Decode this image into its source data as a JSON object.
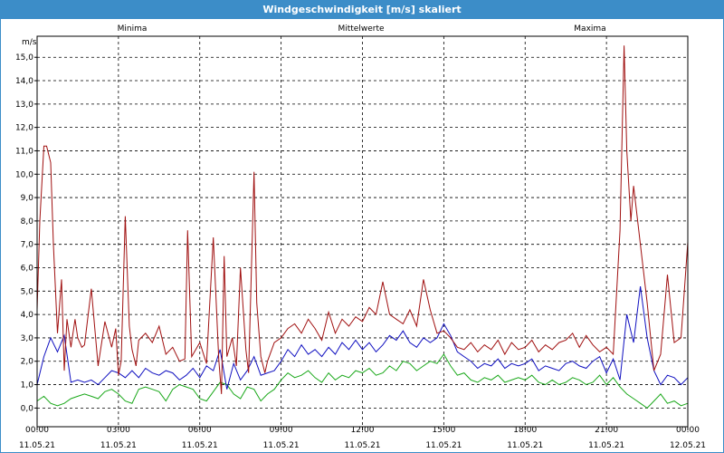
{
  "window": {
    "title": "Windgeschwindigkeit [m/s] skaliert"
  },
  "colors": {
    "min": "#1aa81a",
    "mean": "#1010c0",
    "max": "#a01010",
    "grid": "#000000",
    "titlebar": "#3c8dc8"
  },
  "chart_data": {
    "type": "line",
    "title": "Windgeschwindigkeit [m/s] skaliert",
    "ylabel": "m/s",
    "ylim": [
      -0.8,
      15.9
    ],
    "xlim": [
      0,
      24
    ],
    "grid": true,
    "legend_placement": "top",
    "x_unit": "hours since 11.05.21 00:00",
    "yticks": [
      "0,0",
      "1,0",
      "2,0",
      "3,0",
      "4,0",
      "5,0",
      "6,0",
      "7,0",
      "8,0",
      "9,0",
      "10,0",
      "11,0",
      "12,0",
      "13,0",
      "14,0",
      "15,0"
    ],
    "xticks": [
      {
        "time": "00:00",
        "date": "11.05.21"
      },
      {
        "time": "03:00",
        "date": "11.05.21"
      },
      {
        "time": "06:00",
        "date": "11.05.21"
      },
      {
        "time": "09:00",
        "date": "11.05.21"
      },
      {
        "time": "12:00",
        "date": "11.05.21"
      },
      {
        "time": "15:00",
        "date": "11.05.21"
      },
      {
        "time": "18:00",
        "date": "11.05.21"
      },
      {
        "time": "21:00",
        "date": "11.05.21"
      },
      {
        "time": "00:00",
        "date": "12.05.21"
      }
    ],
    "series": [
      {
        "name": "Minima",
        "x": [
          0.0,
          0.25,
          0.5,
          0.75,
          1.0,
          1.25,
          1.5,
          1.75,
          2.0,
          2.25,
          2.5,
          2.75,
          3.0,
          3.25,
          3.5,
          3.75,
          4.0,
          4.25,
          4.5,
          4.75,
          5.0,
          5.25,
          5.5,
          5.75,
          6.0,
          6.25,
          6.5,
          6.75,
          7.0,
          7.25,
          7.5,
          7.75,
          8.0,
          8.25,
          8.5,
          8.75,
          9.0,
          9.25,
          9.5,
          9.75,
          10.0,
          10.25,
          10.5,
          10.75,
          11.0,
          11.25,
          11.5,
          11.75,
          12.0,
          12.25,
          12.5,
          12.75,
          13.0,
          13.25,
          13.5,
          13.75,
          14.0,
          14.25,
          14.5,
          14.75,
          15.0,
          15.25,
          15.5,
          15.75,
          16.0,
          16.25,
          16.5,
          16.75,
          17.0,
          17.25,
          17.5,
          17.75,
          18.0,
          18.25,
          18.5,
          18.75,
          19.0,
          19.25,
          19.5,
          19.75,
          20.0,
          20.25,
          20.5,
          20.75,
          21.0,
          21.25,
          21.5,
          21.75,
          22.0,
          22.25,
          22.5,
          22.75,
          23.0,
          23.25,
          23.5,
          23.75,
          24.0
        ],
        "values": [
          0.3,
          0.5,
          0.2,
          0.1,
          0.2,
          0.4,
          0.5,
          0.6,
          0.5,
          0.4,
          0.7,
          0.8,
          0.6,
          0.3,
          0.2,
          0.8,
          0.9,
          0.8,
          0.7,
          0.3,
          0.8,
          1.0,
          0.9,
          0.8,
          0.4,
          0.3,
          0.7,
          1.1,
          1.0,
          0.6,
          0.4,
          0.9,
          0.8,
          0.3,
          0.6,
          0.8,
          1.2,
          1.5,
          1.3,
          1.4,
          1.6,
          1.3,
          1.1,
          1.5,
          1.2,
          1.4,
          1.3,
          1.6,
          1.5,
          1.7,
          1.4,
          1.5,
          1.8,
          1.6,
          2.0,
          1.9,
          1.6,
          1.8,
          2.0,
          1.9,
          2.3,
          1.8,
          1.4,
          1.5,
          1.2,
          1.1,
          1.3,
          1.2,
          1.4,
          1.1,
          1.2,
          1.3,
          1.2,
          1.4,
          1.1,
          1.0,
          1.2,
          1.0,
          1.1,
          1.3,
          1.2,
          1.0,
          1.1,
          1.4,
          1.0,
          1.3,
          0.9,
          0.6,
          0.4,
          0.2,
          0.0,
          0.3,
          0.6,
          0.2,
          0.3,
          0.1,
          0.2
        ]
      },
      {
        "name": "Mittelwerte",
        "x": [
          0.0,
          0.25,
          0.5,
          0.75,
          1.0,
          1.25,
          1.5,
          1.75,
          2.0,
          2.25,
          2.5,
          2.75,
          3.0,
          3.25,
          3.5,
          3.75,
          4.0,
          4.25,
          4.5,
          4.75,
          5.0,
          5.25,
          5.5,
          5.75,
          6.0,
          6.25,
          6.5,
          6.75,
          7.0,
          7.25,
          7.5,
          7.75,
          8.0,
          8.25,
          8.5,
          8.75,
          9.0,
          9.25,
          9.5,
          9.75,
          10.0,
          10.25,
          10.5,
          10.75,
          11.0,
          11.25,
          11.5,
          11.75,
          12.0,
          12.25,
          12.5,
          12.75,
          13.0,
          13.25,
          13.5,
          13.75,
          14.0,
          14.25,
          14.5,
          14.75,
          15.0,
          15.25,
          15.5,
          15.75,
          16.0,
          16.25,
          16.5,
          16.75,
          17.0,
          17.25,
          17.5,
          17.75,
          18.0,
          18.25,
          18.5,
          18.75,
          19.0,
          19.25,
          19.5,
          19.75,
          20.0,
          20.25,
          20.5,
          20.75,
          21.0,
          21.25,
          21.5,
          21.75,
          22.0,
          22.25,
          22.5,
          22.75,
          23.0,
          23.25,
          23.5,
          23.75,
          24.0
        ],
        "values": [
          1.0,
          2.2,
          3.0,
          2.4,
          3.1,
          1.1,
          1.2,
          1.1,
          1.2,
          1.0,
          1.3,
          1.6,
          1.5,
          1.3,
          1.6,
          1.3,
          1.7,
          1.5,
          1.4,
          1.6,
          1.5,
          1.2,
          1.4,
          1.7,
          1.3,
          1.8,
          1.6,
          2.5,
          0.8,
          1.9,
          1.2,
          1.6,
          2.2,
          1.4,
          1.5,
          1.6,
          2.0,
          2.5,
          2.2,
          2.7,
          2.3,
          2.5,
          2.2,
          2.6,
          2.3,
          2.8,
          2.5,
          2.9,
          2.5,
          2.8,
          2.4,
          2.7,
          3.1,
          2.9,
          3.3,
          2.8,
          2.6,
          3.0,
          2.8,
          3.0,
          3.6,
          3.1,
          2.4,
          2.2,
          2.0,
          1.7,
          1.9,
          1.8,
          2.1,
          1.7,
          1.9,
          1.8,
          1.9,
          2.1,
          1.6,
          1.8,
          1.7,
          1.6,
          1.9,
          2.0,
          1.8,
          1.7,
          2.0,
          2.2,
          1.5,
          2.1,
          1.2,
          4.0,
          2.8,
          5.2,
          3.0,
          1.6,
          1.0,
          1.4,
          1.3,
          1.0,
          1.3
        ]
      },
      {
        "name": "Maxima",
        "x": [
          0.0,
          0.1,
          0.25,
          0.35,
          0.5,
          0.6,
          0.75,
          0.9,
          1.0,
          1.1,
          1.25,
          1.4,
          1.5,
          1.65,
          1.75,
          2.0,
          2.25,
          2.5,
          2.75,
          2.9,
          3.0,
          3.1,
          3.25,
          3.4,
          3.5,
          3.65,
          3.75,
          4.0,
          4.25,
          4.5,
          4.75,
          5.0,
          5.25,
          5.45,
          5.55,
          5.7,
          6.0,
          6.25,
          6.5,
          6.7,
          6.8,
          6.9,
          7.0,
          7.2,
          7.35,
          7.5,
          7.7,
          7.8,
          8.0,
          8.1,
          8.25,
          8.4,
          8.5,
          8.75,
          9.0,
          9.25,
          9.5,
          9.75,
          10.0,
          10.25,
          10.5,
          10.75,
          11.0,
          11.25,
          11.5,
          11.75,
          12.0,
          12.25,
          12.5,
          12.75,
          13.0,
          13.25,
          13.5,
          13.75,
          14.0,
          14.25,
          14.5,
          14.75,
          15.0,
          15.25,
          15.5,
          15.75,
          16.0,
          16.25,
          16.5,
          16.75,
          17.0,
          17.25,
          17.5,
          17.75,
          18.0,
          18.25,
          18.5,
          18.75,
          19.0,
          19.25,
          19.5,
          19.75,
          20.0,
          20.25,
          20.5,
          20.75,
          21.0,
          21.25,
          21.5,
          21.65,
          21.75,
          21.9,
          22.0,
          22.25,
          22.5,
          22.75,
          23.0,
          23.25,
          23.5,
          23.75,
          24.0
        ],
        "values": [
          4.2,
          8.0,
          11.2,
          11.2,
          10.5,
          7.0,
          3.2,
          5.5,
          1.6,
          3.8,
          2.6,
          3.8,
          3.0,
          2.6,
          2.7,
          5.1,
          1.8,
          3.7,
          2.6,
          3.4,
          1.4,
          2.0,
          8.2,
          3.5,
          2.5,
          1.8,
          2.9,
          3.2,
          2.8,
          3.5,
          2.3,
          2.6,
          2.0,
          2.1,
          7.6,
          2.2,
          2.8,
          1.9,
          7.3,
          2.1,
          0.6,
          6.5,
          2.2,
          3.0,
          1.8,
          6.0,
          2.5,
          1.5,
          10.1,
          4.5,
          2.2,
          1.5,
          2.0,
          2.8,
          3.0,
          3.4,
          3.6,
          3.2,
          3.8,
          3.4,
          2.9,
          4.1,
          3.2,
          3.8,
          3.5,
          3.9,
          3.7,
          4.3,
          4.0,
          5.4,
          4.0,
          3.8,
          3.6,
          4.2,
          3.5,
          5.5,
          4.2,
          3.2,
          3.3,
          3.0,
          2.6,
          2.5,
          2.8,
          2.4,
          2.7,
          2.5,
          2.9,
          2.3,
          2.8,
          2.5,
          2.6,
          2.9,
          2.4,
          2.7,
          2.5,
          2.8,
          2.9,
          3.2,
          2.6,
          3.1,
          2.7,
          2.4,
          2.6,
          2.3,
          7.6,
          15.5,
          11.0,
          8.0,
          9.5,
          7.0,
          4.5,
          1.6,
          2.3,
          5.7,
          2.8,
          3.0,
          7.1
        ]
      }
    ]
  }
}
